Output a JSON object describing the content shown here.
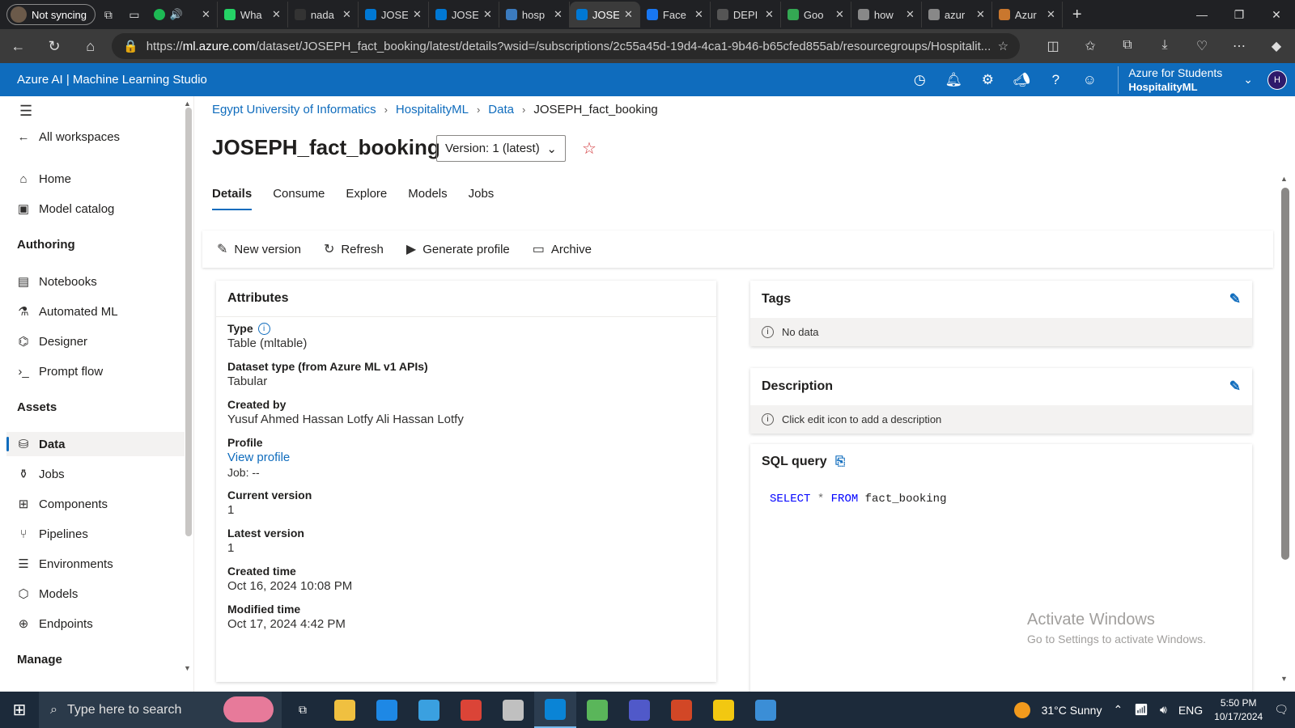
{
  "browser": {
    "profile_label": "Not syncing",
    "tabs": [
      {
        "label": "Wha",
        "color": "#25d366"
      },
      {
        "label": "nada",
        "color": "#333333"
      },
      {
        "label": "JOSE",
        "color": "#0078d4"
      },
      {
        "label": "JOSE",
        "color": "#0078d4"
      },
      {
        "label": "hosp",
        "color": "#3b7bbf"
      },
      {
        "label": "JOSE",
        "color": "#0078d4"
      },
      {
        "label": "Face",
        "color": "#1877f2"
      },
      {
        "label": "DEPI",
        "color": "#555555"
      },
      {
        "label": "Goo",
        "color": "#34a853"
      },
      {
        "label": "how",
        "color": "#888888"
      },
      {
        "label": "azur",
        "color": "#888888"
      },
      {
        "label": "Azur",
        "color": "#c9772e"
      }
    ],
    "url_prefix": "https://",
    "url_host": "ml.azure.com",
    "url_rest": "/dataset/JOSEPH_fact_booking/latest/details?wsid=/subscriptions/2c55a45d-19d4-4ca1-9b46-b65cfed855ab/resourcegroups/Hospitalit..."
  },
  "header": {
    "brand": "Azure AI | Machine Learning Studio",
    "account_name": "Azure for Students",
    "workspace_name": "HospitalityML",
    "user_initial": "H"
  },
  "nav": {
    "all_workspaces": "All workspaces",
    "home": "Home",
    "model_catalog": "Model catalog",
    "authoring_heading": "Authoring",
    "notebooks": "Notebooks",
    "automated_ml": "Automated ML",
    "designer": "Designer",
    "prompt_flow": "Prompt flow",
    "assets_heading": "Assets",
    "data": "Data",
    "jobs": "Jobs",
    "components": "Components",
    "pipelines": "Pipelines",
    "environments": "Environments",
    "models": "Models",
    "endpoints": "Endpoints",
    "manage_heading": "Manage"
  },
  "breadcrumb": [
    "Egypt University of Informatics",
    "HospitalityML",
    "Data",
    "JOSEPH_fact_booking"
  ],
  "page": {
    "title": "JOSEPH_fact_booking",
    "version_selected": "Version: 1 (latest)",
    "tabs": [
      "Details",
      "Consume",
      "Explore",
      "Models",
      "Jobs"
    ]
  },
  "toolbar": {
    "new_version": "New version",
    "refresh": "Refresh",
    "generate_profile": "Generate profile",
    "archive": "Archive"
  },
  "attributes": {
    "title": "Attributes",
    "type_label": "Type",
    "type_value": "Table (mltable)",
    "dataset_type_label": "Dataset type (from Azure ML v1 APIs)",
    "dataset_type_value": "Tabular",
    "created_by_label": "Created by",
    "created_by_value": "Yusuf Ahmed Hassan Lotfy Ali Hassan Lotfy",
    "profile_label": "Profile",
    "profile_link": "View profile",
    "profile_job": "Job: --",
    "current_version_label": "Current version",
    "current_version_value": "1",
    "latest_version_label": "Latest version",
    "latest_version_value": "1",
    "created_time_label": "Created time",
    "created_time_value": "Oct 16, 2024 10:08 PM",
    "modified_time_label": "Modified time",
    "modified_time_value": "Oct 17, 2024 4:42 PM"
  },
  "tags": {
    "title": "Tags",
    "empty_text": "No data"
  },
  "description": {
    "title": "Description",
    "empty_text": "Click edit icon to add a description"
  },
  "sql": {
    "title": "SQL query",
    "kw_select": "SELECT",
    "star": "*",
    "kw_from": "FROM",
    "table": "fact_booking"
  },
  "watermark": {
    "line1": "Activate Windows",
    "line2": "Go to Settings to activate Windows."
  },
  "taskbar": {
    "search_placeholder": "Type here to search",
    "weather": "31°C  Sunny",
    "lang": "ENG",
    "time": "5:50 PM",
    "date": "10/17/2024",
    "app_colors": [
      "#f0c040",
      "#1e88e5",
      "#3aa0e0",
      "#db4437",
      "#c0c0c0",
      "#0a84d6",
      "#5ab65a",
      "#5059c9",
      "#d24726",
      "#f2c811",
      "#3b8ed6"
    ]
  }
}
